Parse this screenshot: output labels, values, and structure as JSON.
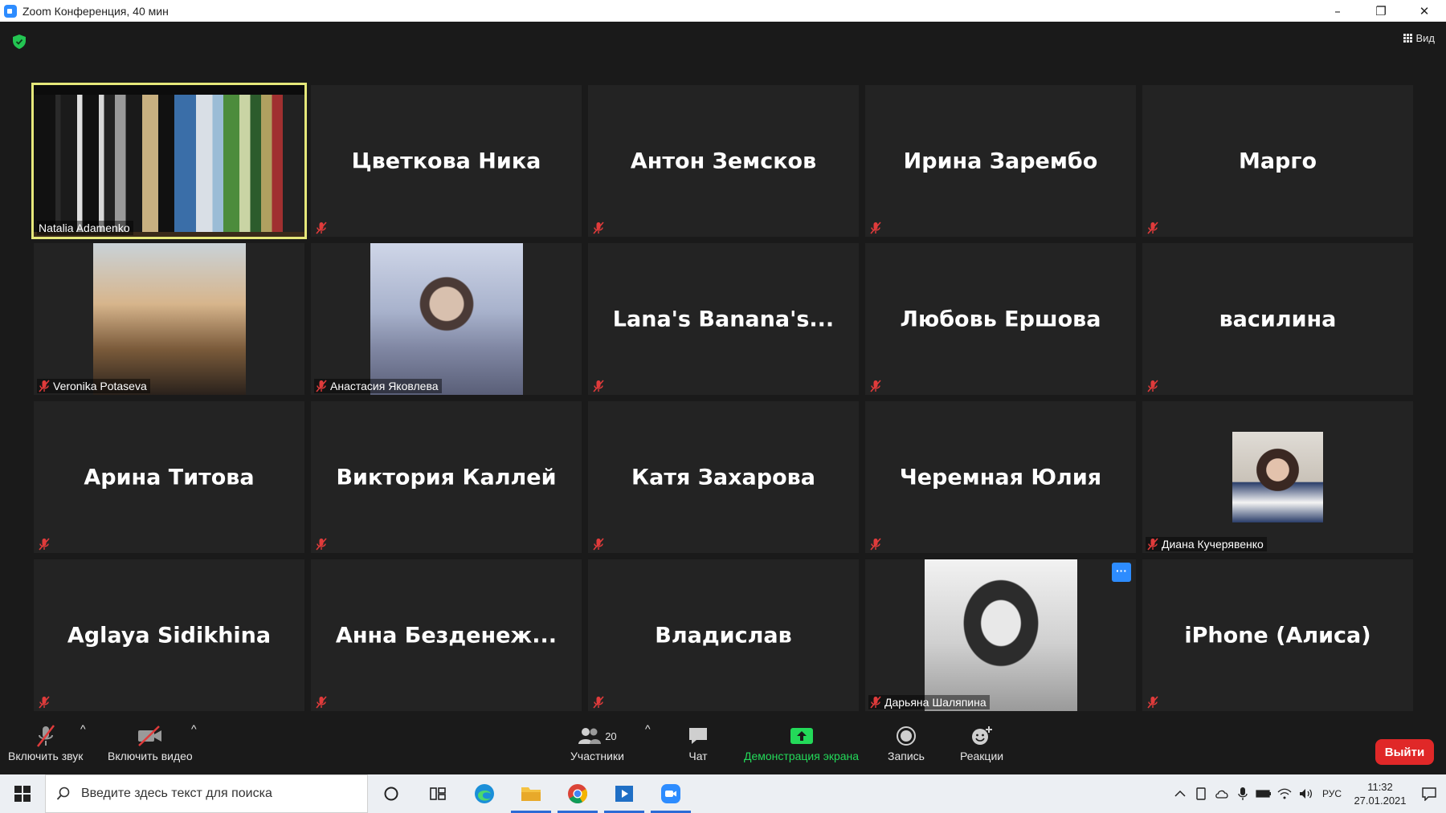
{
  "window": {
    "title": "Zoom Конференция, 40 мин",
    "minimize": "–",
    "restore": "❐",
    "close": "✕"
  },
  "meeting": {
    "view_label": "Вид",
    "tiles": [
      {
        "kind": "video",
        "video": "books",
        "label": "Natalia Adamenko",
        "active": true,
        "muted": false
      },
      {
        "kind": "name",
        "name": "Цветкова Ника",
        "muted": true
      },
      {
        "kind": "name",
        "name": "Антон Земсков",
        "muted": true
      },
      {
        "kind": "name",
        "name": "Ирина Зарембо",
        "muted": true
      },
      {
        "kind": "name",
        "name": "Марго",
        "muted": true
      },
      {
        "kind": "video",
        "video": "veronika",
        "label": "Veronika Potaseva",
        "muted": true
      },
      {
        "kind": "video",
        "video": "anastasia",
        "label": "Анастасия Яковлева",
        "muted": true
      },
      {
        "kind": "name",
        "name": "Lana's  Banana's...",
        "muted": true
      },
      {
        "kind": "name",
        "name": "Любовь Ершова",
        "muted": true
      },
      {
        "kind": "name",
        "name": "василина",
        "muted": true
      },
      {
        "kind": "name",
        "name": "Арина Титова",
        "muted": true
      },
      {
        "kind": "name",
        "name": "Виктория Каллей",
        "muted": true
      },
      {
        "kind": "name",
        "name": "Катя Захарова",
        "muted": true
      },
      {
        "kind": "name",
        "name": "Черемная Юлия",
        "muted": true
      },
      {
        "kind": "video",
        "video": "diana",
        "label": "Диана Кучерявенко",
        "muted": true
      },
      {
        "kind": "name",
        "name": "Aglaya Sidikhina",
        "muted": true
      },
      {
        "kind": "name",
        "name": "Анна  Безденеж...",
        "muted": true
      },
      {
        "kind": "name",
        "name": "Владислав",
        "muted": true
      },
      {
        "kind": "video",
        "video": "daryana",
        "label": "Дарьяна Шаляпина",
        "muted": true,
        "more": true
      },
      {
        "kind": "name",
        "name": "iPhone (Алиса)",
        "muted": true
      }
    ],
    "more_label": "···"
  },
  "controls": {
    "unmute": "Включить звук",
    "start_video": "Включить видео",
    "participants": "Участники",
    "participants_count": "20",
    "chat": "Чат",
    "share_screen": "Демонстрация экрана",
    "record": "Запись",
    "reactions": "Реакции",
    "leave": "Выйти",
    "caret": "^"
  },
  "taskbar": {
    "search_placeholder": "Введите здесь текст для поиска",
    "language": "РУС",
    "time": "11:32",
    "date": "27.01.2021"
  },
  "colors": {
    "accent": "#2d8cff",
    "active_speaker": "#e6e87a",
    "muted_red": "#e03b3b",
    "share_green": "#23d959",
    "leave_red": "#e02828"
  }
}
